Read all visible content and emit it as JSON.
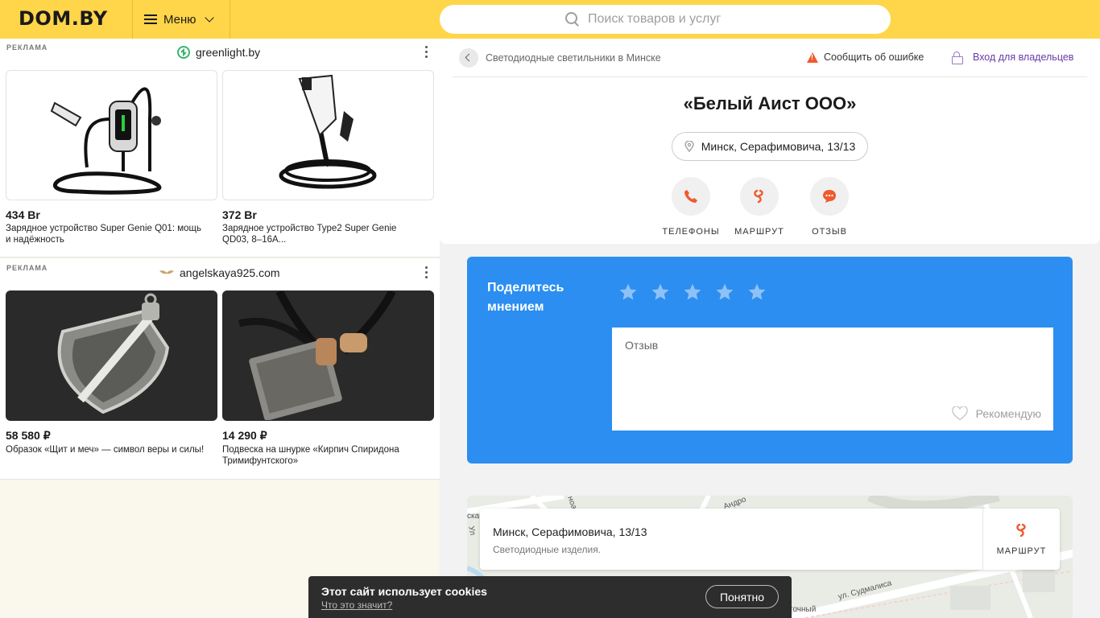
{
  "header": {
    "logo": "DOM.BY",
    "menu_label": "Меню",
    "search_placeholder": "Поиск товаров и услуг"
  },
  "ads": [
    {
      "label": "РЕКЛАМА",
      "source": "greenlight.by",
      "items": [
        {
          "price": "434 Br",
          "desc": "Зарядное устройство Super Genie Q01: мощь и надёжность"
        },
        {
          "price": "372 Br",
          "desc": "Зарядное устройство Type2 Super Genie QD03, 8–16A..."
        }
      ]
    },
    {
      "label": "РЕКЛАМА",
      "source": "angelskaya925.com",
      "items": [
        {
          "price": "58 580 ₽",
          "desc": "Образок «Щит и меч» — символ веры и силы!"
        },
        {
          "price": "14 290 ₽",
          "desc": "Подвеска на шнурке «Кирпич Спиридона Тримифунтского»"
        }
      ]
    }
  ],
  "company": {
    "breadcrumb": "Светодиодные светильники в Минске",
    "report_label": "Сообщить об ошибке",
    "owners_label": "Вход для владельцев",
    "title": "«Белый Аист ООО»",
    "address": "Минск, Серафимовича, 13/13",
    "actions": [
      {
        "label": "ТЕЛЕФОНЫ",
        "icon": "phone-icon"
      },
      {
        "label": "МАРШРУТ",
        "icon": "route-icon"
      },
      {
        "label": "ОТЗЫВ",
        "icon": "chat-bubble-icon"
      }
    ]
  },
  "review": {
    "title": "Поделитесь мнением",
    "stars_total": 5,
    "placeholder": "Отзыв",
    "recommend_label": "Рекомендую"
  },
  "map": {
    "address": "Минск, Серафимовича, 13/13",
    "category": "Светодиодные изделия.",
    "route_label": "МАРШРУТ",
    "street_labels": [
      "Андро",
      "ул. Судмалиса",
      "Ул",
      "ска",
      "точный",
      "ноар"
    ]
  },
  "cookie": {
    "title": "Этот сайт использует cookies",
    "link": "Что это значит?",
    "button": "Понятно"
  },
  "colors": {
    "header_bg": "#ffd54a",
    "accent_orange": "#ef5a2e",
    "review_blue": "#2b8ef0",
    "owners_purple": "#6a3aa8"
  }
}
